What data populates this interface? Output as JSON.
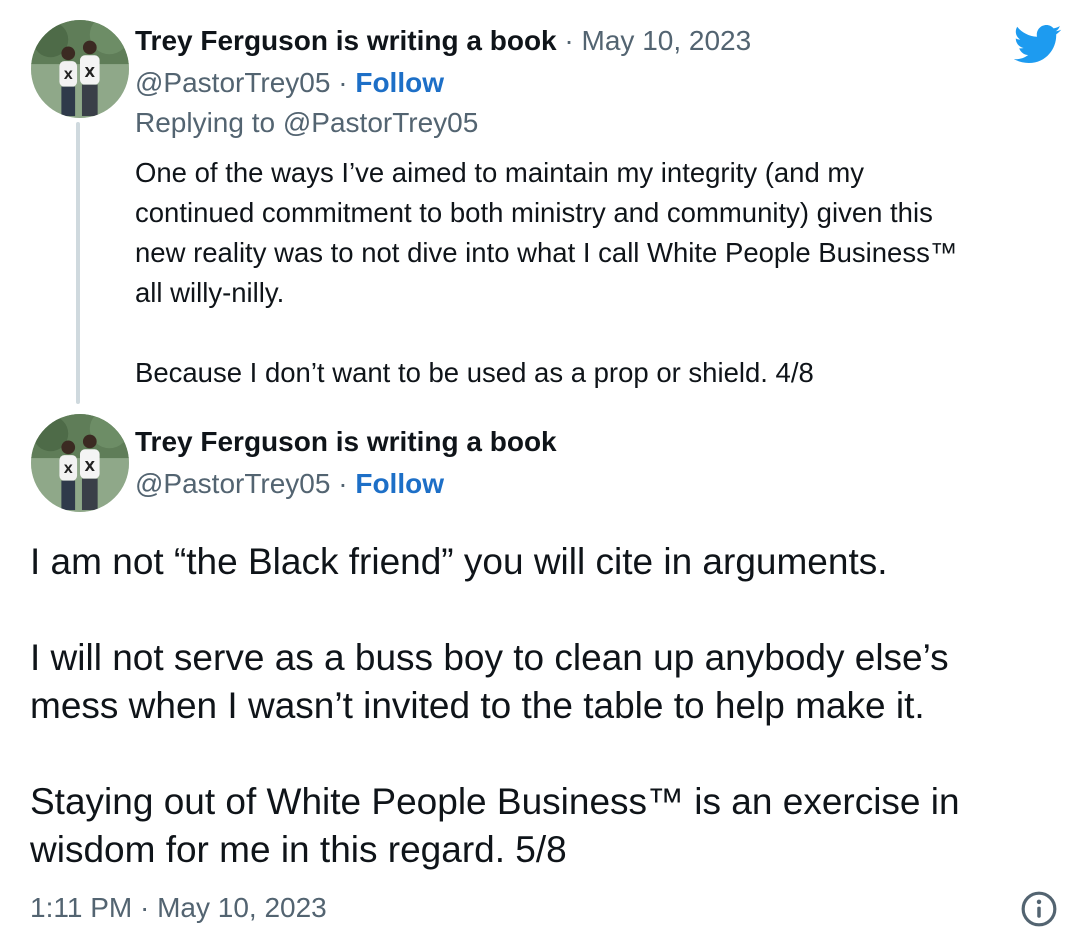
{
  "tweet1": {
    "author_name": "Trey Ferguson is writing a book",
    "separator": "·",
    "date": "May 10, 2023",
    "handle": "@PastorTrey05",
    "handle_sep": "·",
    "follow_label": "Follow",
    "replying_to": "Replying to @PastorTrey05",
    "text": "One of the ways I’ve aimed to maintain my integrity (and my\ncontinued commitment to both ministry and community) given this\nnew reality was to not dive into what I call White People Business™\nall willy-nilly.\n\nBecause I don’t want to be used as a prop or shield. 4/8"
  },
  "tweet2": {
    "author_name": "Trey Ferguson is writing a book",
    "handle": "@PastorTrey05",
    "handle_sep": "·",
    "follow_label": "Follow",
    "text": "I am not “the Black friend” you will cite in arguments.\n\nI will not serve as a buss boy to clean up anybody else’s\nmess when I wasn’t invited to the table to help make it.\n\nStaying out of White People Business™ is an exercise in\nwisdom for me in this regard. 5/8",
    "timestamp": "1:11 PM · May 10, 2023"
  },
  "icons": {
    "brand": "twitter-bird-icon",
    "info": "info-icon"
  },
  "colors": {
    "twitter_blue": "#1d9bf0",
    "follow_blue": "#1d6fc7",
    "secondary_text": "#536471",
    "thread_line": "#cfd9de"
  }
}
